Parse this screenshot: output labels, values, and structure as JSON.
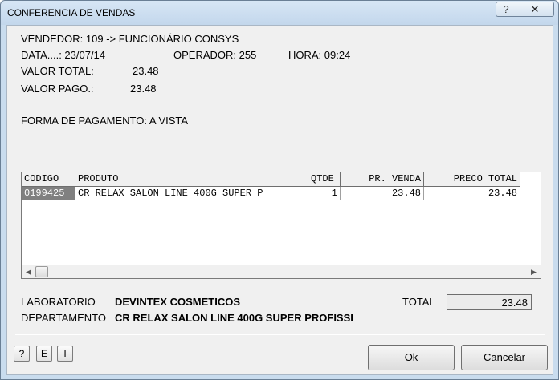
{
  "window": {
    "title": "CONFERENCIA DE VENDAS",
    "help_glyph": "?",
    "close_glyph": "✕"
  },
  "info": {
    "vendedor": "VENDEDOR: 109 -> FUNCIONÁRIO CONSYS",
    "data": "DATA....: 23/07/14",
    "operador": "OPERADOR: 255",
    "hora": "HORA: 09:24",
    "valor_total_label": "VALOR TOTAL:",
    "valor_total": "23.48",
    "valor_pago_label": "VALOR PAGO.:",
    "valor_pago": "23.48",
    "forma_pagamento": "FORMA DE PAGAMENTO: A VISTA"
  },
  "grid": {
    "columns": [
      "CODIGO",
      "PRODUTO",
      "QTDE",
      "PR. VENDA",
      "PRECO TOTAL"
    ],
    "rows": [
      {
        "codigo": "0199425",
        "produto": "CR RELAX SALON LINE 400G SUPER P",
        "qtde": "1",
        "pr_venda": "23.48",
        "preco_total": "23.48"
      }
    ]
  },
  "footer": {
    "laboratorio_label": "LABORATORIO",
    "laboratorio": "DEVINTEX COSMETICOS",
    "departamento_label": "DEPARTAMENTO",
    "departamento": "CR RELAX SALON LINE 400G SUPER PROFISSI",
    "total_label": "TOTAL",
    "total": "23.48"
  },
  "buttons": {
    "help": "?",
    "e": "E",
    "i": "I",
    "ok": "Ok",
    "cancel": "Cancelar"
  }
}
